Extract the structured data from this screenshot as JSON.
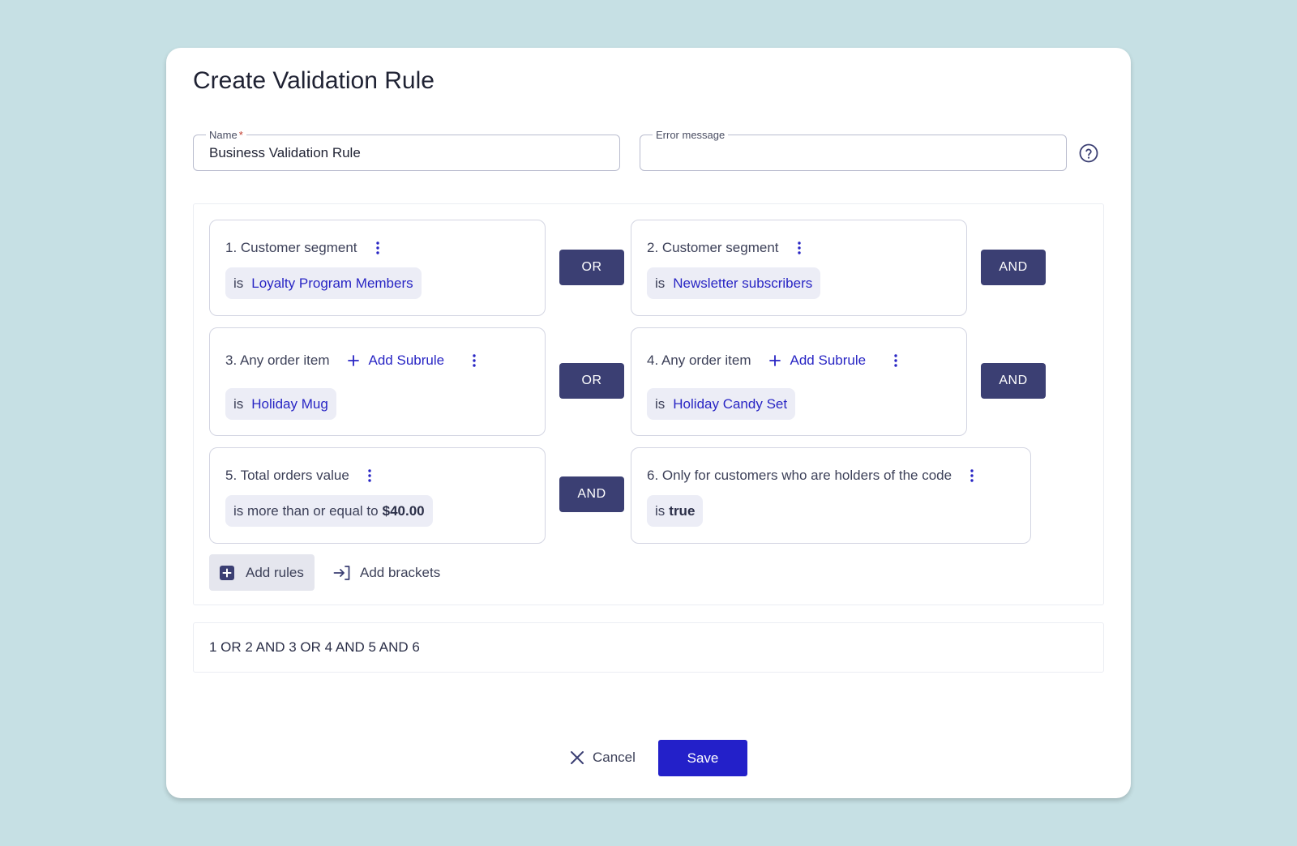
{
  "dialog": {
    "title": "Create Validation Rule",
    "name_field": {
      "label": "Name",
      "required_mark": "*",
      "value": "Business Validation Rule"
    },
    "error_field": {
      "label": "Error message",
      "value": ""
    },
    "help_icon": "help-circle-icon"
  },
  "rules": [
    {
      "header": "1. Customer segment",
      "prefix": "is",
      "value": "Loyalty Program Members",
      "operator": "OR"
    },
    {
      "header": "2. Customer segment",
      "prefix": "is",
      "value": "Newsletter subscribers",
      "operator": "AND"
    },
    {
      "header": "3. Any order item",
      "add_subrule": "Add Subrule",
      "prefix": "is",
      "value": "Holiday Mug",
      "operator": "OR"
    },
    {
      "header": "4. Any order item",
      "add_subrule": "Add Subrule",
      "prefix": "is",
      "value": "Holiday Candy Set",
      "operator": "AND"
    },
    {
      "header": "5. Total orders value",
      "prefix": "is more than or equal to",
      "value": "$40.00",
      "operator": "AND"
    },
    {
      "header": "6. Only for customers who are holders of the code",
      "prefix": "is",
      "value": "true"
    }
  ],
  "actions": {
    "add_rules": "Add rules",
    "add_brackets": "Add brackets"
  },
  "expression": "1 OR 2 AND 3 OR 4 AND 5 AND 6",
  "footer": {
    "cancel": "Cancel",
    "save": "Save"
  },
  "colors": {
    "background": "#c6e0e4",
    "operator": "#3b3f73",
    "accent": "#2320c9",
    "link": "#2825c4"
  }
}
